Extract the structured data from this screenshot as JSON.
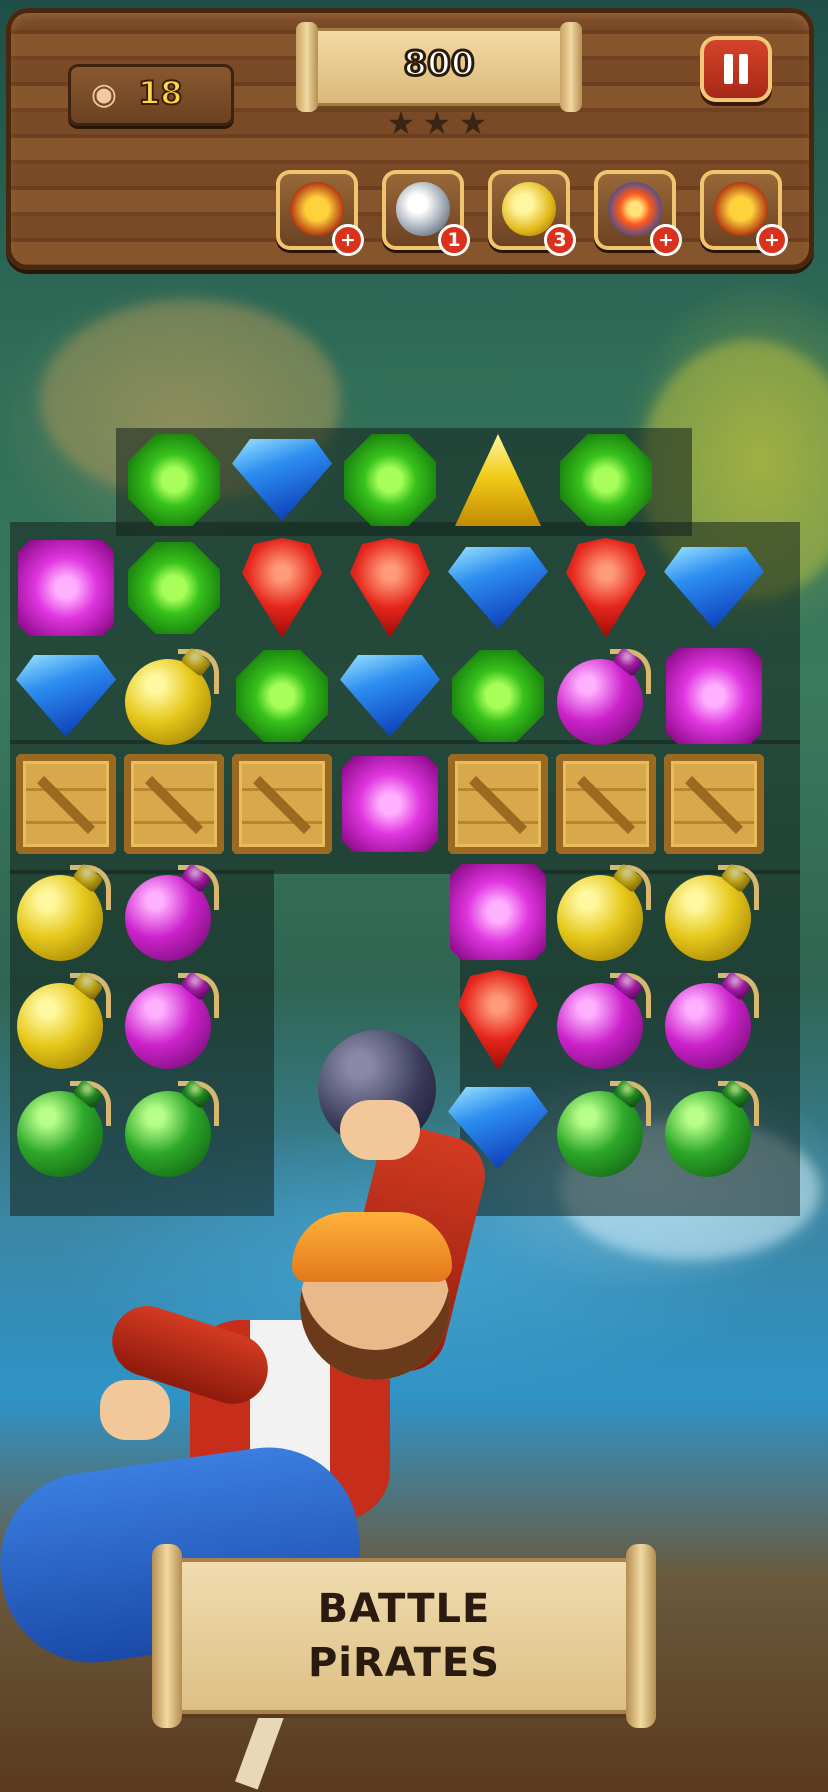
{
  "header": {
    "moves_left": "18",
    "score": "800",
    "stars_earned": 0,
    "stars_total": 3
  },
  "boosters": [
    {
      "icon": "lightning-icon",
      "badge": "+"
    },
    {
      "icon": "silver-potion-icon",
      "badge": "1"
    },
    {
      "icon": "gold-potion-icon",
      "badge": "3"
    },
    {
      "icon": "fire-orb-icon",
      "badge": "+"
    },
    {
      "icon": "double-lightning-icon",
      "badge": "+"
    }
  ],
  "board": {
    "rows": [
      [
        "",
        "green",
        "blue",
        "green",
        "yellow",
        "green",
        ""
      ],
      [
        "purple",
        "green",
        "red",
        "red",
        "blue",
        "red",
        "blue"
      ],
      [
        "blue",
        "bomb-yellow",
        "green",
        "blue",
        "green",
        "bomb-purple",
        "purple"
      ],
      [
        "crate",
        "crate",
        "crate",
        "purple",
        "crate",
        "crate",
        "crate"
      ],
      [
        "bomb-yellow",
        "bomb-purple",
        "",
        "",
        "purple",
        "bomb-yellow",
        "bomb-yellow"
      ],
      [
        "bomb-yellow",
        "bomb-purple",
        "",
        "",
        "red",
        "bomb-purple",
        "bomb-purple"
      ],
      [
        "bomb-green",
        "bomb-green",
        "",
        "",
        "blue",
        "bomb-green",
        "bomb-green"
      ]
    ]
  },
  "banner": {
    "line1": "BATTLE",
    "line2": "PiRATES"
  },
  "colors": {
    "wood": "#7a4a26",
    "score_text": "#ffffff",
    "moves_text": "#ffd54a",
    "pause": "#c33a22"
  }
}
